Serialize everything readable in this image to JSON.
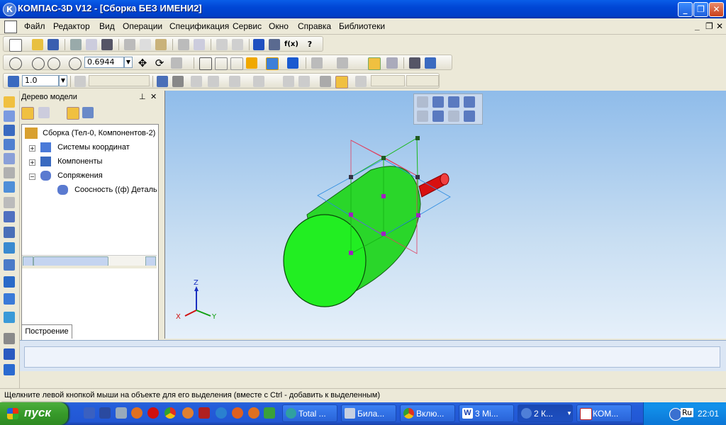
{
  "window": {
    "title": "КОМПАС-3D V12 - [Сборка БЕЗ ИМЕНИ2]",
    "app_icon": "К",
    "buttons": {
      "minimize": "_",
      "maximize": "❐",
      "close": "✕"
    }
  },
  "menu": {
    "items": [
      "Файл",
      "Редактор",
      "Вид",
      "Операции",
      "Спецификация",
      "Сервис",
      "Окно",
      "Справка",
      "Библиотеки"
    ],
    "doc_controls": {
      "minimize": "_",
      "restore": "❐",
      "close": "✕"
    }
  },
  "toolbar2": {
    "zoom_value": "0.6944",
    "fx_label": "f(x)"
  },
  "toolbar3": {
    "step_value": "1.0"
  },
  "tree": {
    "title": "Дерево модели",
    "pin": "⊥",
    "close": "✕",
    "root": "Сборка (Тел-0, Компонентов-2)",
    "nodes": [
      {
        "label": "Системы координат",
        "expander": "+"
      },
      {
        "label": "Компоненты",
        "expander": "+"
      },
      {
        "label": "Сопряжения",
        "expander": "−"
      }
    ],
    "child": "Соосность ((ф) Деталь",
    "tab": "Построение"
  },
  "axes": {
    "x": "X",
    "y": "Y",
    "z": "Z"
  },
  "colors": {
    "body": "#22dd22",
    "shaft": "#e01010",
    "accent": "#0046d5"
  },
  "status": {
    "text": "Щелкните левой кнопкой мыши на объекте для его выделения (вместе с Ctrl - добавить к выделенным)"
  },
  "taskbar": {
    "start": "пуск",
    "tasks": [
      "Total ...",
      "Била...",
      "Вклю...",
      "3 Mi...",
      "2 К...",
      "КОМ..."
    ],
    "lang": "RU",
    "tray_lang": "Ru",
    "time": "22:01"
  }
}
